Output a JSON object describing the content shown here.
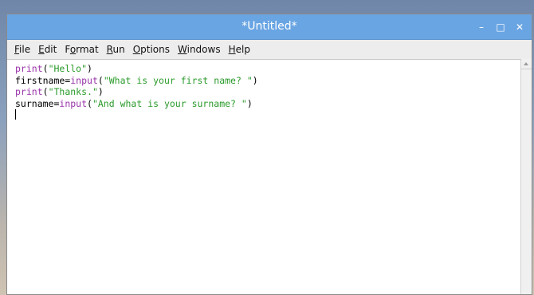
{
  "window": {
    "title": "*Untitled*",
    "controls": {
      "minimize": "–",
      "maximize": "□",
      "close": "✕"
    }
  },
  "menubar": {
    "items": [
      {
        "mnemonic": "F",
        "rest": "ile"
      },
      {
        "mnemonic": "E",
        "rest": "dit"
      },
      {
        "pre": "F",
        "mnemonic": "o",
        "rest": "rmat"
      },
      {
        "mnemonic": "R",
        "rest": "un"
      },
      {
        "mnemonic": "O",
        "rest": "ptions"
      },
      {
        "mnemonic": "W",
        "rest": "indows"
      },
      {
        "mnemonic": "H",
        "rest": "elp"
      }
    ]
  },
  "editor": {
    "lines": [
      [
        {
          "t": "print",
          "c": "kw"
        },
        {
          "t": "(",
          "c": ""
        },
        {
          "t": "\"Hello\"",
          "c": "str"
        },
        {
          "t": ")",
          "c": ""
        }
      ],
      [
        {
          "t": "firstname=",
          "c": ""
        },
        {
          "t": "input",
          "c": "kw"
        },
        {
          "t": "(",
          "c": ""
        },
        {
          "t": "\"What is your first name? \"",
          "c": "str"
        },
        {
          "t": ")",
          "c": ""
        }
      ],
      [
        {
          "t": "print",
          "c": "kw"
        },
        {
          "t": "(",
          "c": ""
        },
        {
          "t": "\"Thanks.\"",
          "c": "str"
        },
        {
          "t": ")",
          "c": ""
        }
      ],
      [
        {
          "t": "surname=",
          "c": ""
        },
        {
          "t": "input",
          "c": "kw"
        },
        {
          "t": "(",
          "c": ""
        },
        {
          "t": "\"And what is your surname? \"",
          "c": "str"
        },
        {
          "t": ")",
          "c": ""
        }
      ]
    ]
  },
  "colors": {
    "titlebar": "#6aa5e3",
    "keyword": "#9933aa",
    "string": "#2a9a2a"
  }
}
